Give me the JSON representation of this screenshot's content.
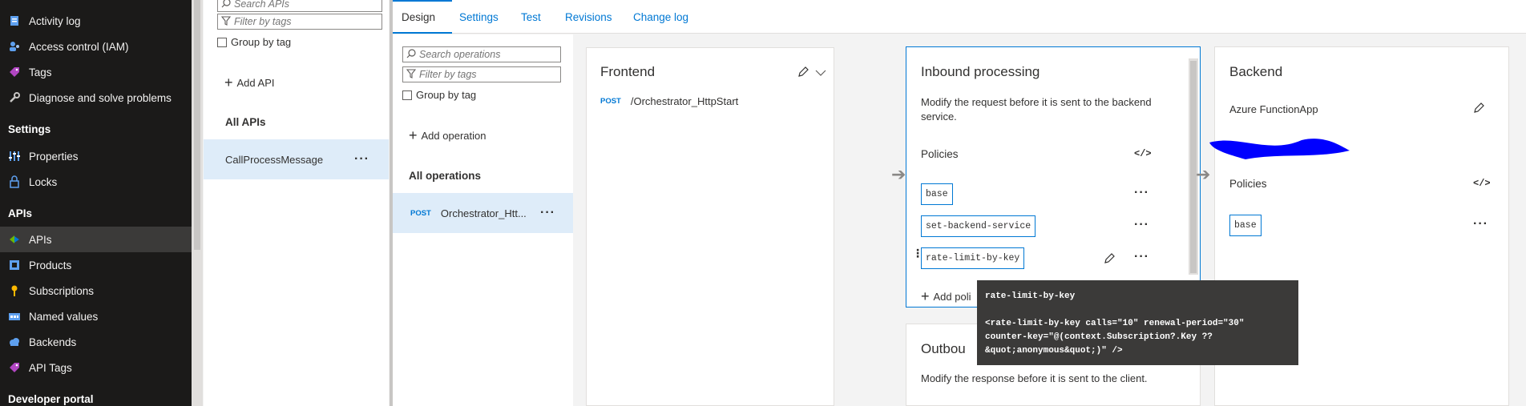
{
  "nav": {
    "items": [
      {
        "label": "Activity log",
        "icon": "activity-log-icon"
      },
      {
        "label": "Access control (IAM)",
        "icon": "iam-icon"
      },
      {
        "label": "Tags",
        "icon": "tag-icon"
      },
      {
        "label": "Diagnose and solve problems",
        "icon": "wrench-icon"
      }
    ],
    "settings_header": "Settings",
    "settings_items": [
      {
        "label": "Properties",
        "icon": "properties-icon"
      },
      {
        "label": "Locks",
        "icon": "lock-icon"
      }
    ],
    "apis_header": "APIs",
    "apis_items": [
      {
        "label": "APIs",
        "icon": "apis-icon"
      },
      {
        "label": "Products",
        "icon": "products-icon"
      },
      {
        "label": "Subscriptions",
        "icon": "key-icon"
      },
      {
        "label": "Named values",
        "icon": "named-values-icon"
      },
      {
        "label": "Backends",
        "icon": "cloud-icon"
      },
      {
        "label": "API Tags",
        "icon": "tag-icon"
      }
    ],
    "dev_header": "Developer portal"
  },
  "apilist": {
    "search_placeholder": "Search APIs",
    "filter_placeholder": "Filter by tags",
    "group_by_tag": "Group by tag",
    "add_api": "Add API",
    "group_title": "All APIs",
    "apis": [
      {
        "name": "CallProcessMessage"
      }
    ]
  },
  "tabs": [
    "Design",
    "Settings",
    "Test",
    "Revisions",
    "Change log"
  ],
  "ops": {
    "search_placeholder": "Search operations",
    "filter_placeholder": "Filter by tags",
    "group_by_tag": "Group by tag",
    "add_operation": "Add operation",
    "group_title": "All operations",
    "operations": [
      {
        "method": "POST",
        "name": "Orchestrator_Htt..."
      }
    ]
  },
  "frontend": {
    "title": "Frontend",
    "method": "POST",
    "path": "/Orchestrator_HttpStart"
  },
  "inbound": {
    "title": "Inbound processing",
    "description": "Modify the request before it is sent to the backend service.",
    "policies_label": "Policies",
    "code_icon": "</>",
    "policies": [
      "base",
      "set-backend-service",
      "rate-limit-by-key"
    ],
    "add_policy": "Add poli"
  },
  "outbound": {
    "title": "Outbou",
    "description": "Modify the response before it is sent to the client."
  },
  "backend": {
    "title": "Backend",
    "type": "Azure FunctionApp",
    "policies_label": "Policies",
    "code_icon": "</>",
    "policies": [
      "base"
    ]
  },
  "tooltip": {
    "title": "rate-limit-by-key",
    "line1": "<rate-limit-by-key calls=\"10\" renewal-period=\"30\"",
    "line2": "counter-key=\"@(context.Subscription?.Key ??",
    "line3": "&quot;anonymous&quot;)\" />"
  },
  "colors": {
    "accent": "#0078d4",
    "nav_bg": "#1b1a19",
    "selected_row": "#deecf9",
    "redaction": "#0000ff"
  }
}
